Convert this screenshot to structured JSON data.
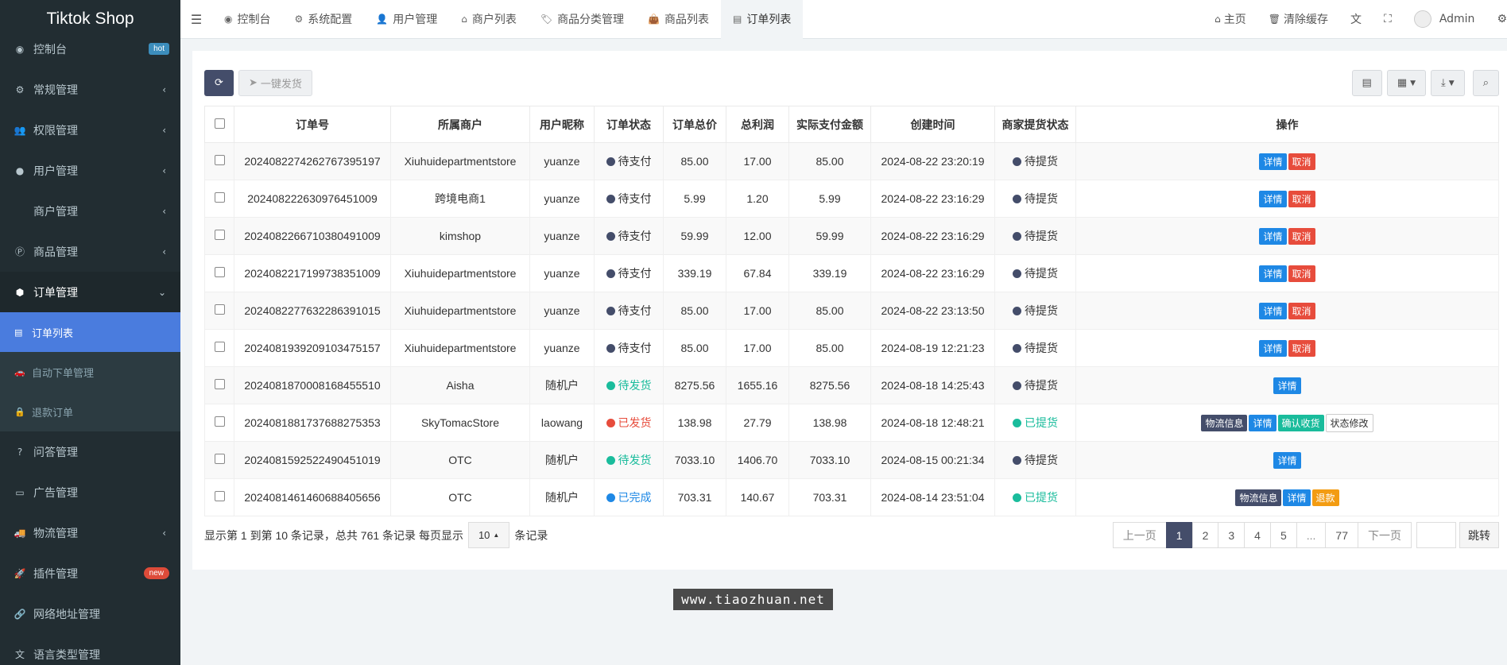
{
  "app": {
    "title": "Tiktok Shop"
  },
  "sidebar": {
    "items": [
      {
        "icon": "dashboard-icon",
        "glyph": "◉",
        "label": "控制台",
        "badge": "hot"
      },
      {
        "icon": "cogs-icon",
        "glyph": "⚙",
        "label": "常规管理",
        "arrow": "‹"
      },
      {
        "icon": "users-icon",
        "glyph": "👥",
        "label": "权限管理",
        "arrow": "‹"
      },
      {
        "icon": "user-circle-icon",
        "glyph": "●",
        "label": "用户管理",
        "arrow": "‹"
      },
      {
        "icon": "apple-icon",
        "glyph": "",
        "label": "商户管理",
        "arrow": "‹"
      },
      {
        "icon": "product-hunt-icon",
        "glyph": "Ⓟ",
        "label": "商品管理",
        "arrow": "‹"
      },
      {
        "icon": "cube-icon",
        "glyph": "⬢",
        "label": "订单管理",
        "arrow": "⌄"
      }
    ],
    "sub_items": [
      {
        "icon": "list-icon",
        "glyph": "▤",
        "label": "订单列表"
      },
      {
        "icon": "car-icon",
        "glyph": "🚗",
        "label": "自动下单管理"
      },
      {
        "icon": "lock-icon",
        "glyph": "🔒",
        "label": "退款订单"
      }
    ],
    "items2": [
      {
        "icon": "question-circle-icon",
        "glyph": "?",
        "label": "问答管理"
      },
      {
        "icon": "ad-icon",
        "glyph": "▭",
        "label": "广告管理"
      },
      {
        "icon": "truck-icon",
        "glyph": "🚚",
        "label": "物流管理",
        "arrow": "‹"
      },
      {
        "icon": "rocket-icon",
        "glyph": "🚀",
        "label": "插件管理",
        "badge": "new"
      },
      {
        "icon": "link-icon",
        "glyph": "🔗",
        "label": "网络地址管理"
      },
      {
        "icon": "language-icon",
        "glyph": "文",
        "label": "语言类型管理"
      }
    ]
  },
  "topbar": {
    "tabs": [
      {
        "icon": "dashboard-icon",
        "glyph": "◉",
        "label": "控制台"
      },
      {
        "icon": "cog-icon",
        "glyph": "⚙",
        "label": "系统配置"
      },
      {
        "icon": "user-icon",
        "glyph": "👤",
        "label": "用户管理"
      },
      {
        "icon": "home-icon",
        "glyph": "⌂",
        "label": "商户列表"
      },
      {
        "icon": "tag-icon",
        "glyph": "🏷",
        "label": "商品分类管理"
      },
      {
        "icon": "shopping-bag-icon",
        "glyph": "👜",
        "label": "商品列表"
      },
      {
        "icon": "list-alt-icon",
        "glyph": "▤",
        "label": "订单列表"
      }
    ],
    "home": "主页",
    "clear_cache": "清除缓存",
    "user": "Admin"
  },
  "toolbar": {
    "one_click_ship": "一键发货"
  },
  "table": {
    "headers": [
      "订单号",
      "所属商户",
      "用户昵称",
      "订单状态",
      "订单总价",
      "总利润",
      "实际支付金额",
      "创建时间",
      "商家提货状态",
      "操作"
    ],
    "rows": [
      {
        "order_no": "202408227426276739 5197",
        "merchant": "Xiuhui department store",
        "nick": "yuanze",
        "status": "待支付",
        "status_color": "#444d6a",
        "total": "85.00",
        "profit": "17.00",
        "paid": "85.00",
        "created": "2024-08-22 23:20:19",
        "pickup": "待提货",
        "pickup_color": "#444d6a",
        "pickup_text_color": "#333",
        "actions": [
          {
            "label": "详情",
            "color": "#1e88e5"
          },
          {
            "label": "取消",
            "color": "#e74c3c"
          }
        ]
      },
      {
        "order_no": "202408222630976451009",
        "merchant": "跨境电商1",
        "nick": "yuanze",
        "status": "待支付",
        "status_color": "#444d6a",
        "total": "5.99",
        "profit": "1.20",
        "paid": "5.99",
        "created": "2024-08-22 23:16:29",
        "pickup": "待提货",
        "pickup_color": "#444d6a",
        "pickup_text_color": "#333",
        "actions": [
          {
            "label": "详情",
            "color": "#1e88e5"
          },
          {
            "label": "取消",
            "color": "#e74c3c"
          }
        ]
      },
      {
        "order_no": "202408226671038049 1009",
        "merchant": "kim shop",
        "nick": "yuanze",
        "status": "待支付",
        "status_color": "#444d6a",
        "total": "59.99",
        "profit": "12.00",
        "paid": "59.99",
        "created": "2024-08-22 23:16:29",
        "pickup": "待提货",
        "pickup_color": "#444d6a",
        "pickup_text_color": "#333",
        "actions": [
          {
            "label": "详情",
            "color": "#1e88e5"
          },
          {
            "label": "取消",
            "color": "#e74c3c"
          }
        ]
      },
      {
        "order_no": "202408221719973835 1009",
        "merchant": "Xiuhui department store",
        "nick": "yuanze",
        "status": "待支付",
        "status_color": "#444d6a",
        "total": "339.19",
        "profit": "67.84",
        "paid": "339.19",
        "created": "2024-08-22 23:16:29",
        "pickup": "待提货",
        "pickup_color": "#444d6a",
        "pickup_text_color": "#333",
        "actions": [
          {
            "label": "详情",
            "color": "#1e88e5"
          },
          {
            "label": "取消",
            "color": "#e74c3c"
          }
        ]
      },
      {
        "order_no": "202408227763228639 1015",
        "merchant": "Xiuhui department store",
        "nick": "yuanze",
        "status": "待支付",
        "status_color": "#444d6a",
        "total": "85.00",
        "profit": "17.00",
        "paid": "85.00",
        "created": "2024-08-22 23:13:50",
        "pickup": "待提货",
        "pickup_color": "#444d6a",
        "pickup_text_color": "#333",
        "actions": [
          {
            "label": "详情",
            "color": "#1e88e5"
          },
          {
            "label": "取消",
            "color": "#e74c3c"
          }
        ]
      },
      {
        "order_no": "202408193920910347 5157",
        "merchant": "Xiuhui department store",
        "nick": "yuanze",
        "status": "待支付",
        "status_color": "#444d6a",
        "total": "85.00",
        "profit": "17.00",
        "paid": "85.00",
        "created": "2024-08-19 12:21:23",
        "pickup": "待提货",
        "pickup_color": "#444d6a",
        "pickup_text_color": "#333",
        "actions": [
          {
            "label": "详情",
            "color": "#1e88e5"
          },
          {
            "label": "取消",
            "color": "#e74c3c"
          }
        ]
      },
      {
        "order_no": "202408187000816845 5510",
        "merchant": "Aisha",
        "nick": "随机户",
        "status": "待发货",
        "status_color": "#1abc9c",
        "status_text_color": "#1abc9c",
        "total": "8275.56",
        "profit": "1655.16",
        "paid": "8275.56",
        "created": "2024-08-18 14:25:43",
        "pickup": "待提货",
        "pickup_color": "#444d6a",
        "pickup_text_color": "#333",
        "actions": [
          {
            "label": "详情",
            "color": "#1e88e5"
          }
        ]
      },
      {
        "order_no": "202408188173768827 5353",
        "merchant": "SkyTomac Store",
        "nick": "laowang",
        "status": "已发货",
        "status_color": "#e74c3c",
        "status_text_color": "#e74c3c",
        "total": "138.98",
        "profit": "27.79",
        "paid": "138.98",
        "created": "2024-08-18 12:48:21",
        "pickup": "已提货",
        "pickup_color": "#1abc9c",
        "pickup_text_color": "#1abc9c",
        "actions": [
          {
            "label": "物流信息",
            "color": "#444d6a"
          },
          {
            "label": "详情",
            "color": "#1e88e5"
          },
          {
            "label": "确认收货",
            "color": "#1abc9c"
          },
          {
            "label": "状态修改",
            "color": "#ffffff",
            "text": "#333",
            "border": "#ccc"
          }
        ]
      },
      {
        "order_no": "202408159252249045 1019",
        "merchant": "OTC",
        "nick": "随机户",
        "status": "待发货",
        "status_color": "#1abc9c",
        "status_text_color": "#1abc9c",
        "total": "7033.10",
        "profit": "1406.70",
        "paid": "7033.10",
        "created": "2024-08-15 00:21:34",
        "pickup": "待提货",
        "pickup_color": "#444d6a",
        "pickup_text_color": "#333",
        "actions": [
          {
            "label": "详情",
            "color": "#1e88e5"
          }
        ]
      },
      {
        "order_no": "202408146146068840 5656",
        "merchant": "OTC",
        "nick": "随机户",
        "status": "已完成",
        "status_color": "#1e88e5",
        "status_text_color": "#1e88e5",
        "total": "703.31",
        "profit": "140.67",
        "paid": "703.31",
        "created": "2024-08-14 23:51:04",
        "pickup": "已提货",
        "pickup_color": "#1abc9c",
        "pickup_text_color": "#1abc9c",
        "actions": [
          {
            "label": "物流信息",
            "color": "#444d6a"
          },
          {
            "label": "详情",
            "color": "#1e88e5"
          },
          {
            "label": "退款",
            "color": "#f39c12"
          }
        ]
      }
    ]
  },
  "footer": {
    "info_prefix": "显示第 1 到第 10 条记录，总共 761 条记录 每页显示",
    "page_size": "10",
    "info_suffix": "条记录",
    "pages": [
      "上一页",
      "1",
      "2",
      "3",
      "4",
      "5",
      "...",
      "77",
      "下一页"
    ],
    "current_page": "1",
    "go": "跳转"
  },
  "watermark": "www.tiaozhuan.net"
}
